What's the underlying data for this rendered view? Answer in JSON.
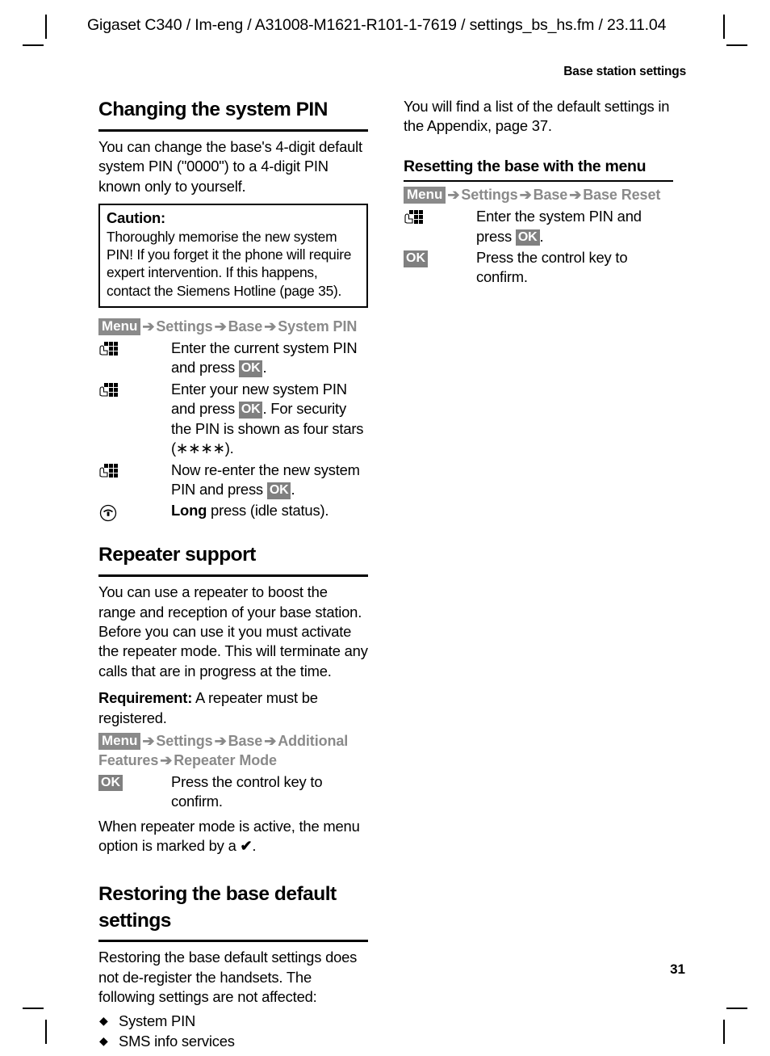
{
  "header": {
    "slug": "Gigaset C340 / Im-eng / A31008-M1621-R101-1-7619 / settings_bs_hs.fm / 23.11.04",
    "running_head": "Base station settings"
  },
  "footer": {
    "page_number": "31"
  },
  "colors": {
    "menu_badge_bg": "#8a8a8a",
    "menu_text": "#8a8a8a",
    "ok_badge_bg": "#808080",
    "rule": "#000000"
  },
  "left_column": {
    "section_1": {
      "heading": "Changing the system PIN",
      "intro": "You can change the base's 4-digit default system PIN (\"0000\") to a 4-digit PIN known only to yourself.",
      "caution": {
        "title": "Caution:",
        "body": "Thoroughly memorise the new system PIN! If you forget it the phone will require expert intervention. If this happens, contact the Siemens Hotline (page 35)."
      },
      "menu_path": {
        "menu_label": "Menu",
        "steps": [
          "Settings",
          "Base",
          "System PIN"
        ],
        "arrow": "➔"
      },
      "instructions": [
        {
          "icon": "keypad-icon",
          "text_before": "Enter the current system PIN and press ",
          "badge": "OK",
          "text_after": "."
        },
        {
          "icon": "keypad-icon",
          "text_before": "Enter your new system PIN and press ",
          "badge": "OK",
          "text_after": ". For security the PIN is shown as four stars (∗∗∗∗)."
        },
        {
          "icon": "keypad-icon",
          "text_before": "Now re-enter the new system PIN and press ",
          "badge": "OK",
          "text_after": "."
        },
        {
          "icon": "end-call-icon",
          "text_bold": "Long",
          "text_after": " press (idle status)."
        }
      ]
    },
    "section_2": {
      "heading": "Repeater support",
      "intro": "You can use a repeater to boost the range and reception of your base station. Before you can use it you must activate the repeater mode. This will terminate any calls that are in progress at the time.",
      "requirement_label": "Requirement:",
      "requirement_text": " A repeater must be registered.",
      "menu_path": {
        "menu_label": "Menu",
        "steps": [
          "Settings",
          "Base",
          "Additional Features",
          "Repeater Mode"
        ],
        "arrow": "➔"
      },
      "instruction": {
        "badge": "OK",
        "text": "Press the control key to confirm."
      },
      "note_before": "When repeater mode is active, the menu option is marked by a ",
      "note_check": "✔",
      "note_after": "."
    },
    "section_3": {
      "heading": "Restoring the base default settings",
      "intro": "Restoring the base default settings does not de-register the handsets. The following settings are not affected:",
      "bullets": [
        "System PIN",
        "SMS info services"
      ],
      "bullet_glyph": "◆"
    }
  },
  "right_column": {
    "intro": "You will find a list of the default settings in the Appendix, page 37.",
    "section": {
      "heading": "Resetting the base with the menu",
      "menu_path": {
        "menu_label": "Menu",
        "steps": [
          "Settings",
          "Base",
          "Base Reset"
        ],
        "arrow": "➔"
      },
      "instructions": [
        {
          "icon": "keypad-icon",
          "text_before": "Enter the system PIN and press ",
          "badge": "OK",
          "text_after": "."
        },
        {
          "icon": "ok-badge",
          "badge": "OK",
          "text": "Press the control key to confirm."
        }
      ]
    }
  }
}
